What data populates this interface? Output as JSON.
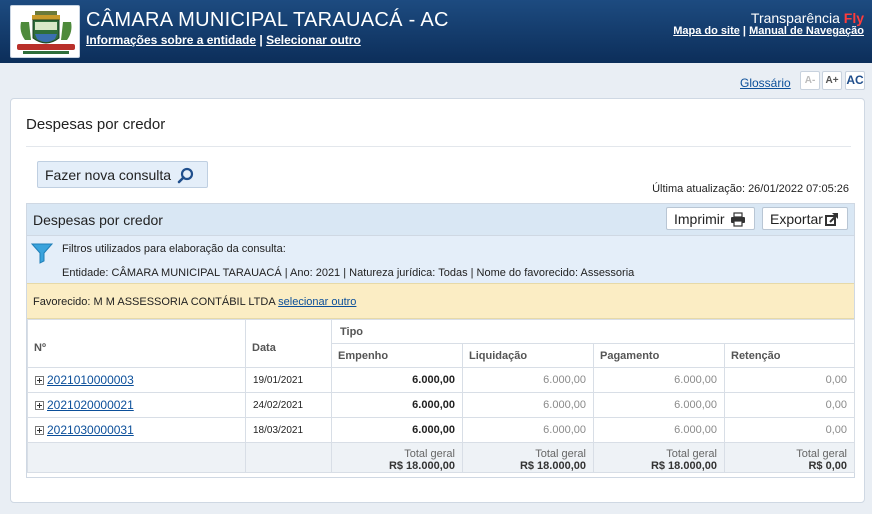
{
  "header": {
    "title": "CÂMARA MUNICIPAL TARAUACÁ - AC",
    "link_info": "Informações sobre a entidade",
    "separator": "|",
    "link_select": "Selecionar outro",
    "brand_main": "Transparência ",
    "brand_fly": "Fly",
    "link_sitemap": "Mapa do site",
    "link_manual": "Manual de Navegação"
  },
  "toolbar": {
    "glossario": "Glossário",
    "font_decrease": "A-",
    "font_increase": "A+",
    "contrast": "AC"
  },
  "page": {
    "title": "Despesas por credor",
    "new_query_button": "Fazer nova consulta",
    "last_update": "Última atualização: 26/01/2022 07:05:26"
  },
  "section": {
    "title": "Despesas por credor",
    "print_button": "Imprimir",
    "export_button": "Exportar",
    "filters_label": "Filtros utilizados para elaboração da consulta:",
    "filters_desc": "Entidade: CÂMARA MUNICIPAL TARAUACÁ | Ano: 2021 | Natureza jurídica: Todas | Nome do favorecido: Assessoria",
    "favored_label": "Favorecido: M M ASSESSORIA CONTÁBIL LTDA ",
    "favored_link": "selecionar outro"
  },
  "table": {
    "headers": {
      "numero": "Nº",
      "data": "Data",
      "tipo": "Tipo",
      "empenho": "Empenho",
      "liquidacao": "Liquidação",
      "pagamento": "Pagamento",
      "retencao": "Retenção"
    },
    "rows": [
      {
        "numero": "2021010000003",
        "data": "19/01/2021",
        "empenho": "6.000,00",
        "liquidacao": "6.000,00",
        "pagamento": "6.000,00",
        "retencao": "0,00"
      },
      {
        "numero": "2021020000021",
        "data": "24/02/2021",
        "empenho": "6.000,00",
        "liquidacao": "6.000,00",
        "pagamento": "6.000,00",
        "retencao": "0,00"
      },
      {
        "numero": "2021030000031",
        "data": "18/03/2021",
        "empenho": "6.000,00",
        "liquidacao": "6.000,00",
        "pagamento": "6.000,00",
        "retencao": "0,00"
      }
    ],
    "totals": {
      "label": "Total geral",
      "empenho": "R$ 18.000,00",
      "liquidacao": "R$ 18.000,00",
      "pagamento": "R$ 18.000,00",
      "retencao": "R$ 0,00"
    }
  },
  "colors": {
    "header_bg": "#0c2e5a",
    "link": "#0b4f9a",
    "favored_bg": "#fbedc4",
    "filters_bg": "#e4eef9",
    "brand_fly": "#ff3c3c"
  },
  "icons": [
    "municipal-crest-logo",
    "magnifier-icon",
    "printer-icon",
    "export-icon",
    "funnel-icon",
    "expand-plus-icon"
  ]
}
